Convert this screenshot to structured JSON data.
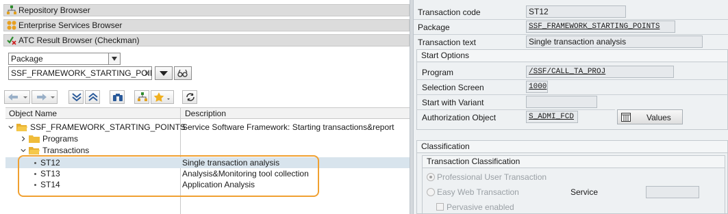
{
  "left": {
    "browsers": {
      "repository": "Repository Browser",
      "enterprise_services": "Enterprise Services Browser",
      "atc": "ATC Result Browser (Checkman)"
    },
    "object_type": "Package",
    "object_input": "SSF_FRAMEWORK_STARTING_POIN",
    "tree": {
      "headers": {
        "name": "Object Name",
        "description": "Description"
      },
      "root": {
        "name": "SSF_FRAMEWORK_STARTING_POINTS",
        "description": "Service Software Framework: Starting transactions&report"
      },
      "programs": "Programs",
      "transactions": "Transactions",
      "items": [
        {
          "name": "ST12",
          "description": "Single transaction analysis"
        },
        {
          "name": "ST13",
          "description": "Analysis&Monitoring tool collection"
        },
        {
          "name": "ST14",
          "description": "Application Analysis"
        }
      ]
    }
  },
  "right": {
    "transaction_code_label": "Transaction code",
    "transaction_code": "ST12",
    "package_label": "Package",
    "package": "SSF_FRAMEWORK_STARTING_POINTS",
    "transaction_text_label": "Transaction text",
    "transaction_text": "Single transaction analysis",
    "start_options": {
      "title": "Start Options",
      "program_label": "Program",
      "program": "/SSF/CALL_TA_PROJ",
      "selection_screen_label": "Selection Screen",
      "selection_screen": "1000",
      "start_with_variant_label": "Start with Variant",
      "start_with_variant": "",
      "auth_object_label": "Authorization Object",
      "auth_object": "S_ADMI_FCD",
      "values_button": "Values"
    },
    "classification": {
      "title": "Classification",
      "subtitle": "Transaction Classification",
      "professional": "Professional User Transaction",
      "easy_web": "Easy Web Transaction",
      "service_label": "Service",
      "pervasive": "Pervasive enabled"
    }
  }
}
